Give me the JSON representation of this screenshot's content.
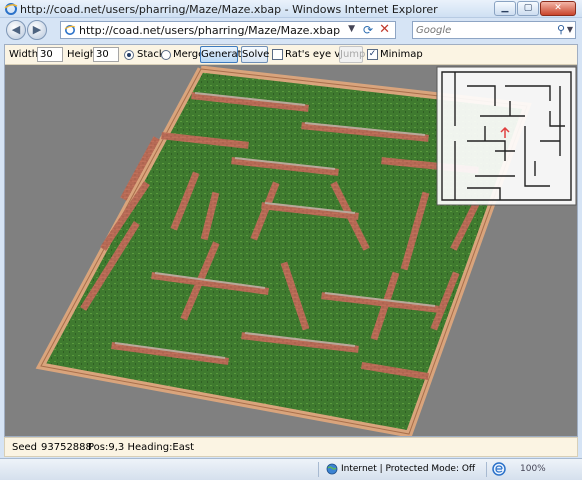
{
  "window": {
    "title": "http://coad.net/users/pharring/Maze/Maze.xbap - Windows Internet Explorer",
    "controls": [
      "minimize",
      "maximize",
      "close"
    ]
  },
  "navigation": {
    "address_url": "http://coad.net/users/pharring/Maze/Maze.xbap",
    "search_placeholder": "Google"
  },
  "toolbar": {
    "width_label": "Width",
    "width_value": "30",
    "height_label": "Height",
    "height_value": "30",
    "stack_label": "Stack",
    "stack_selected": true,
    "merge_label": "Merge",
    "merge_selected": false,
    "generate_label": "Generate",
    "solve_label": "Solve",
    "rats_eye_label": "Rat's eye view",
    "rats_eye_checked": false,
    "jump_label": "Jump",
    "jump_enabled": false,
    "minimap_label": "Minimap",
    "minimap_checked": true
  },
  "info": {
    "seed_label": "Seed",
    "seed_value": "93752888",
    "position_text": "Pos:9,3 Heading:East"
  },
  "statusbar": {
    "zone_text": "Internet | Protected Mode: Off",
    "zoom_text": "100%"
  },
  "colors": {
    "background": "#808080",
    "grass": "#3f7a2f",
    "brick": "#c0705a",
    "wall_top": "#b8a89a",
    "fence": "#d9a47c",
    "minimap_bg": "#ffffff",
    "minimap_wall": "#222222",
    "minimap_marker": "#e04040"
  }
}
